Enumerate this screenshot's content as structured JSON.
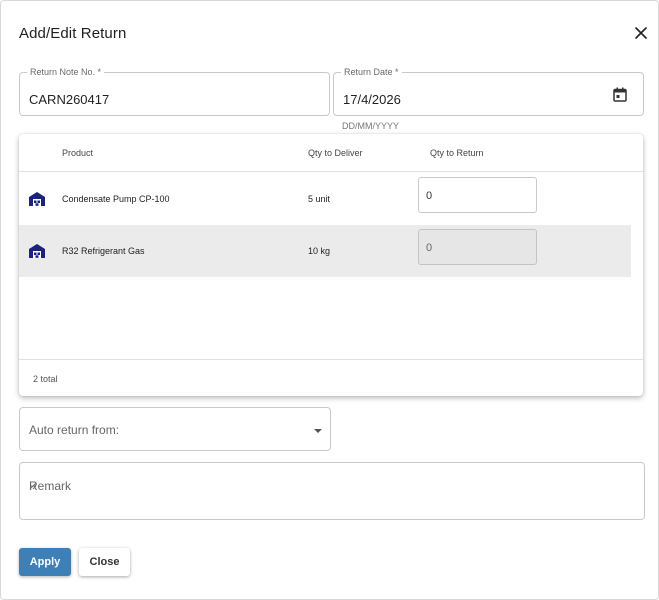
{
  "dialog": {
    "title": "Add/Edit Return",
    "close_icon": "close-icon"
  },
  "form": {
    "return_note": {
      "label": "Return Note No. *",
      "value": "CARN260417"
    },
    "return_date": {
      "label": "Return Date *",
      "value": "17/4/2026",
      "helper": "DD/MM/YYYY",
      "icon": "calendar-icon"
    }
  },
  "grid": {
    "columns": {
      "product": "Product",
      "qty_deliver": "Qty to Deliver",
      "qty_return": "Qty to Return"
    },
    "rows": [
      {
        "icon": "warehouse-icon",
        "product": "Condensate Pump CP-100",
        "qty_deliver": "5 unit",
        "qty_return": "0",
        "selected": false
      },
      {
        "icon": "warehouse-icon",
        "product": "R32 Refrigerant Gas",
        "qty_deliver": "10 kg",
        "qty_return": "0",
        "selected": true
      }
    ],
    "footer": "2 total"
  },
  "auto_return": {
    "placeholder": "Auto return from:"
  },
  "remark": {
    "placeholder": "Remark"
  },
  "buttons": {
    "apply": "Apply",
    "close": "Close"
  },
  "colors": {
    "primary": "#3f7fb8",
    "icon": "#1a237e",
    "selected_row": "#ebebeb"
  }
}
